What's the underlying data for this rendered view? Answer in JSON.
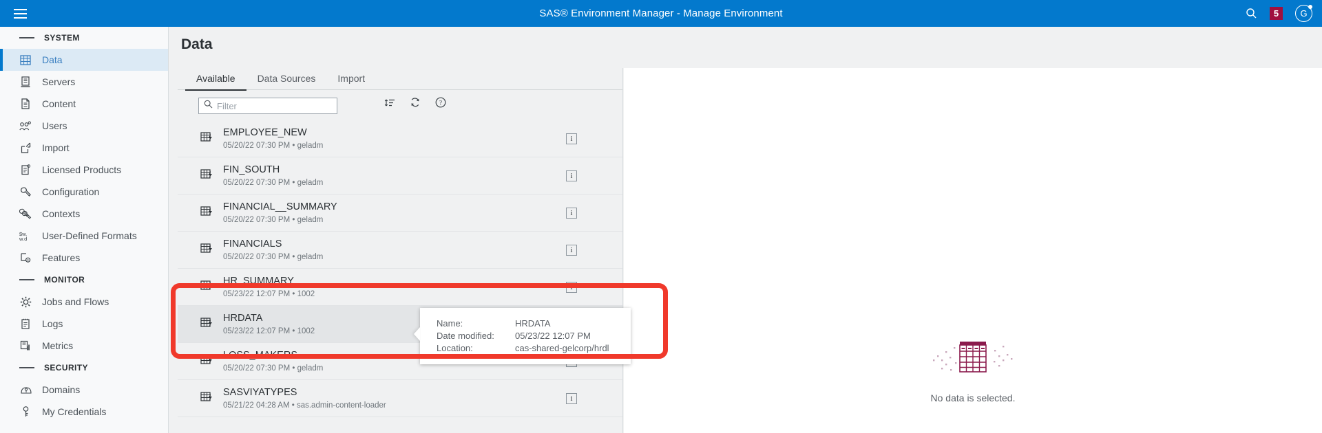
{
  "appbar": {
    "menu_icon": "hamburger-icon",
    "title": "SAS® Environment Manager - Manage Environment",
    "search_icon": "search-icon",
    "badge_count": "5",
    "avatar_initial": "G",
    "background": "#0379cd"
  },
  "sidebar": {
    "groups": [
      {
        "label": "SYSTEM",
        "items": [
          {
            "label": "Data",
            "icon": "table-grid-icon",
            "active": true
          },
          {
            "label": "Servers",
            "icon": "server-icon",
            "active": false
          },
          {
            "label": "Content",
            "icon": "document-icon",
            "active": false
          },
          {
            "label": "Users",
            "icon": "users-icon",
            "active": false
          },
          {
            "label": "Import",
            "icon": "import-arrow-icon",
            "active": false
          },
          {
            "label": "Licensed Products",
            "icon": "clipboard-icon",
            "active": false
          },
          {
            "label": "Configuration",
            "icon": "wrench-icon",
            "active": false
          },
          {
            "label": "Contexts",
            "icon": "double-wrench-icon",
            "active": false
          },
          {
            "label": "User-Defined Formats",
            "icon": "format-code-icon",
            "active": false
          },
          {
            "label": "Features",
            "icon": "features-gear-icon",
            "active": false
          }
        ]
      },
      {
        "label": "MONITOR",
        "items": [
          {
            "label": "Jobs and Flows",
            "icon": "gear-icon",
            "active": false
          },
          {
            "label": "Logs",
            "icon": "log-list-icon",
            "active": false
          },
          {
            "label": "Metrics",
            "icon": "bar-chart-icon",
            "active": false
          }
        ]
      },
      {
        "label": "SECURITY",
        "items": [
          {
            "label": "Domains",
            "icon": "domain-key-icon",
            "active": false
          },
          {
            "label": "My Credentials",
            "icon": "key-icon",
            "active": false
          }
        ]
      }
    ]
  },
  "main": {
    "page_title": "Data",
    "tabs": [
      {
        "label": "Available",
        "active": true
      },
      {
        "label": "Data Sources",
        "active": false
      },
      {
        "label": "Import",
        "active": false
      }
    ],
    "filter": {
      "placeholder": "Filter",
      "value": "",
      "icon": "search-icon"
    },
    "toolbar_icons": [
      {
        "name": "sort-icon"
      },
      {
        "name": "refresh-icon"
      },
      {
        "name": "help-icon"
      }
    ],
    "list": [
      {
        "name": "EMPLOYEE_NEW",
        "meta": "05/20/22 07:30 PM • geladm",
        "selected": false,
        "icon": "table-lightning-icon",
        "info_icon": "info-icon"
      },
      {
        "name": "FIN_SOUTH",
        "meta": "05/20/22 07:30 PM • geladm",
        "selected": false,
        "icon": "table-lightning-icon",
        "info_icon": "info-icon"
      },
      {
        "name": "FINANCIAL__SUMMARY",
        "meta": "05/20/22 07:30 PM • geladm",
        "selected": false,
        "icon": "table-lightning-icon",
        "info_icon": "info-icon"
      },
      {
        "name": "FINANCIALS",
        "meta": "05/20/22 07:30 PM • geladm",
        "selected": false,
        "icon": "table-lightning-icon",
        "info_icon": "info-icon"
      },
      {
        "name": "HR_SUMMARY",
        "meta": "05/23/22 12:07 PM • 1002",
        "selected": false,
        "icon": "table-lightning-icon",
        "info_icon": "info-icon"
      },
      {
        "name": "HRDATA",
        "meta": "05/23/22 12:07 PM • 1002",
        "selected": true,
        "icon": "table-lightning-icon",
        "info_icon": "info-icon"
      },
      {
        "name": "LOSS_MAKERS",
        "meta": "05/20/22 07:30 PM • geladm",
        "selected": false,
        "icon": "table-lightning-icon",
        "info_icon": "info-icon"
      },
      {
        "name": "SASVIYATYPES",
        "meta": "05/21/22 04:28 AM • sas.admin-content-loader",
        "selected": false,
        "icon": "table-lightning-icon",
        "info_icon": "info-icon"
      }
    ]
  },
  "tooltip": {
    "rows": [
      {
        "key": "Name:",
        "value": "HRDATA"
      },
      {
        "key": "Date modified:",
        "value": "05/23/22 12:07 PM"
      },
      {
        "key": "Location:",
        "value": "cas-shared-gelcorp/hrdl"
      }
    ]
  },
  "right_pane": {
    "empty_icon": "table-placeholder-icon",
    "empty_text": "No data is selected.",
    "accent_color": "#8b1a4c"
  },
  "annotation": {
    "name": "red-highlight-box",
    "color": "#f0392b"
  }
}
